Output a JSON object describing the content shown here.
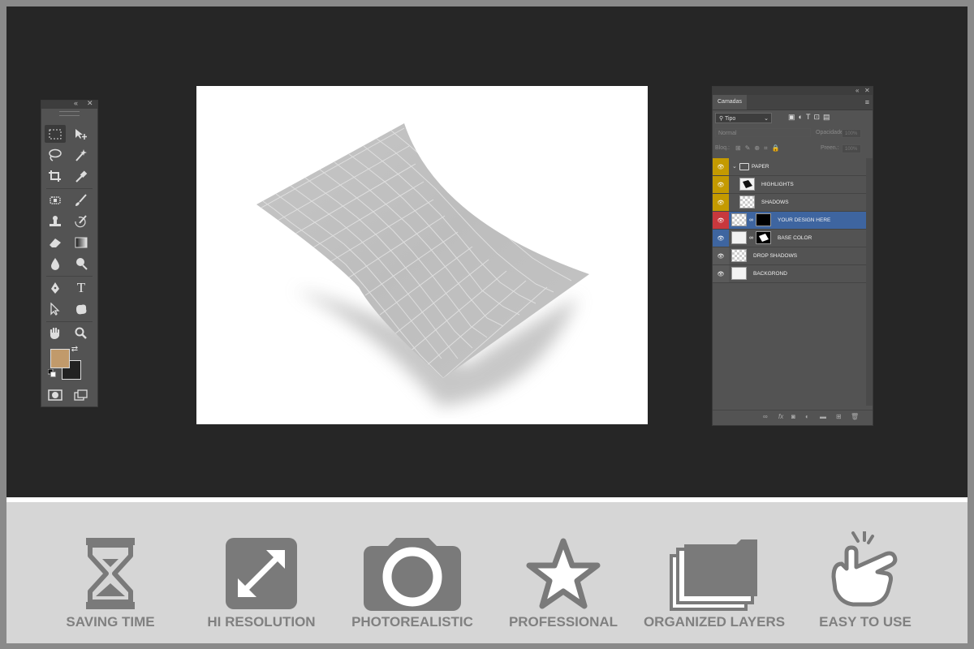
{
  "colors": {
    "workspace": "#262626",
    "panel": "#535353",
    "selected_layer": "#3e65a0",
    "foreground_swatch": "#c19a6b",
    "feature_bar": "#d6d6d6",
    "feature_icon": "#7a7a7a"
  },
  "toolbox": {
    "collapse_icon": "«",
    "close_icon": "✕",
    "type_tool_glyph": "T"
  },
  "layers_panel": {
    "collapse_icon": "«",
    "close_icon": "✕",
    "tab_label": "Camadas",
    "menu_icon": "≡",
    "filter": {
      "selected": "Tipo"
    },
    "blend_mode": "Normal",
    "opacity_label": "Opacidade:",
    "opacity_value": "100%",
    "lock_label": "Bloq.:",
    "fill_label": "Preen.:",
    "fill_value": "100%",
    "layers": [
      {
        "name": "PAPER",
        "eye_color": "#c49a00",
        "type": "group"
      },
      {
        "name": "HIGHLIGHTS",
        "eye_color": "#c49a00",
        "type": "layer"
      },
      {
        "name": "SHADOWS",
        "eye_color": "#c49a00",
        "type": "layer"
      },
      {
        "name": "YOUR DESIGN HERE",
        "eye_color": "#c8383d",
        "type": "smart",
        "selected": true
      },
      {
        "name": "BASE COLOR",
        "eye_color": "#3e65a0",
        "type": "layer"
      },
      {
        "name": "DROP SHADOWS",
        "eye_color": "#5a5a5a",
        "type": "layer"
      },
      {
        "name": "BACKGROND",
        "eye_color": "#5a5a5a",
        "type": "layer"
      }
    ],
    "footer_icons": [
      "link-icon",
      "fx-icon",
      "mask-icon",
      "adjustment-icon",
      "folder-icon",
      "new-layer-icon",
      "trash-icon"
    ]
  },
  "features": [
    {
      "label": "SAVING TIME",
      "icon": "hourglass-icon"
    },
    {
      "label": "HI RESOLUTION",
      "icon": "expand-arrows-icon"
    },
    {
      "label": "PHOTOREALISTIC",
      "icon": "camera-icon"
    },
    {
      "label": "PROFESSIONAL",
      "icon": "star-icon"
    },
    {
      "label": "ORGANIZED LAYERS",
      "icon": "stacked-folders-icon"
    },
    {
      "label": "EASY TO USE",
      "icon": "pointing-hand-icon"
    }
  ]
}
